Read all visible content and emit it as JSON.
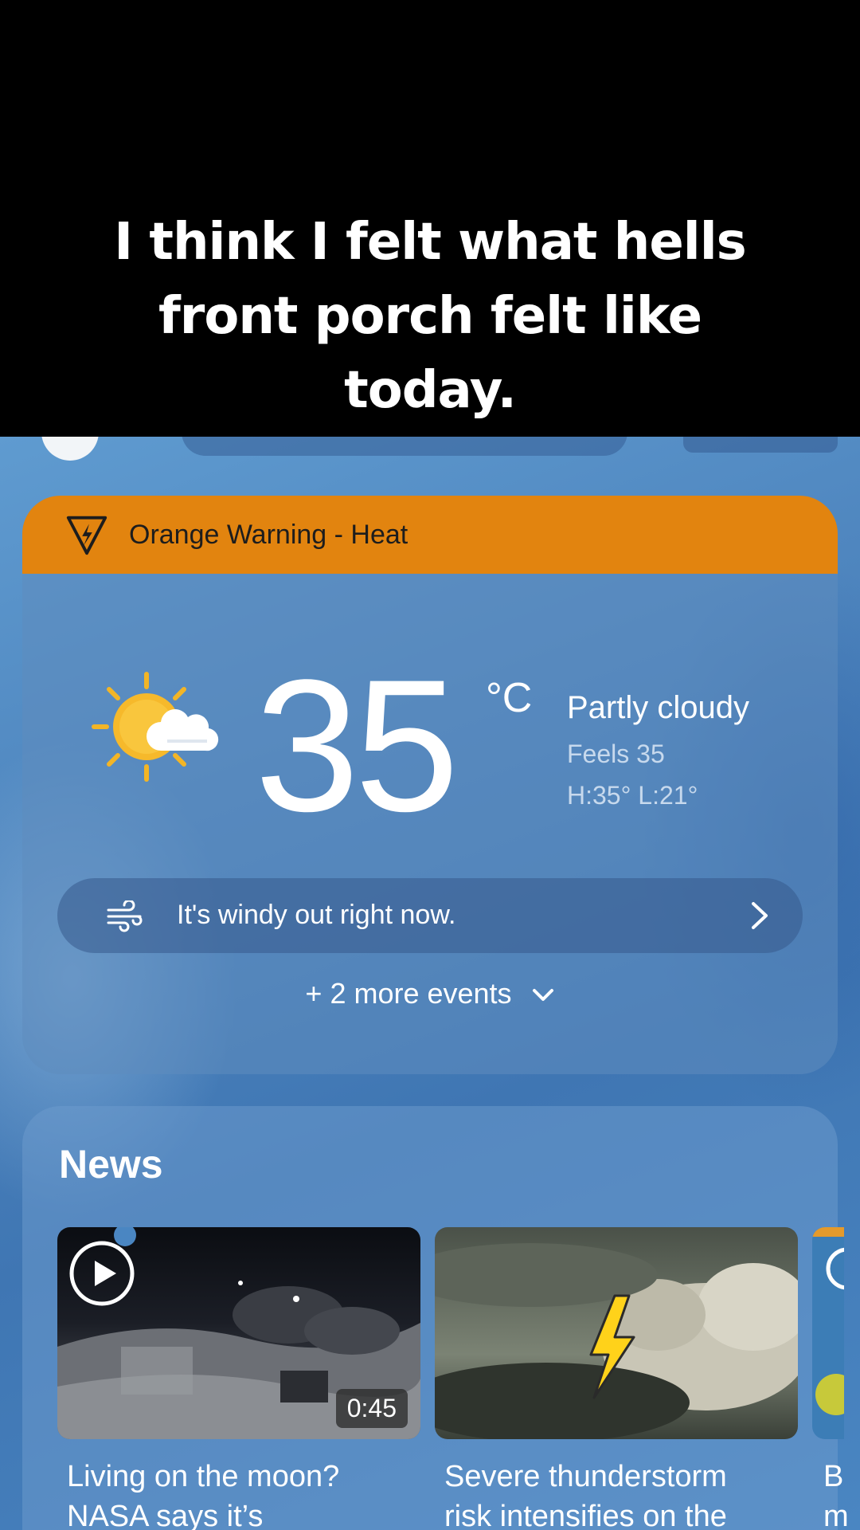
{
  "caption": {
    "line1": "I think I felt what hells",
    "line2": "front porch felt like",
    "line3": "today."
  },
  "alert": {
    "text": "Orange Warning - Heat",
    "color": "#e2840f",
    "icon": "warning-triangle-icon"
  },
  "current": {
    "temperature": "35",
    "unit": "°C",
    "condition": "Partly cloudy",
    "feels_like": "Feels 35",
    "high_low": "H:35° L:21°",
    "icon": "partly-cloudy-icon"
  },
  "wind_notice": {
    "text": "It's windy out right now.",
    "icon": "wind-icon"
  },
  "more_events": {
    "label": "+ 2 more events"
  },
  "news": {
    "title": "News",
    "items": [
      {
        "line1": "Living on the moon?",
        "line2": "NASA says it’s",
        "duration": "0:45",
        "is_video": true
      },
      {
        "line1": "Severe thunderstorm",
        "line2": "risk intensifies on the",
        "is_video": false
      },
      {
        "line1": "B",
        "line2": "m",
        "is_video": true
      }
    ]
  }
}
